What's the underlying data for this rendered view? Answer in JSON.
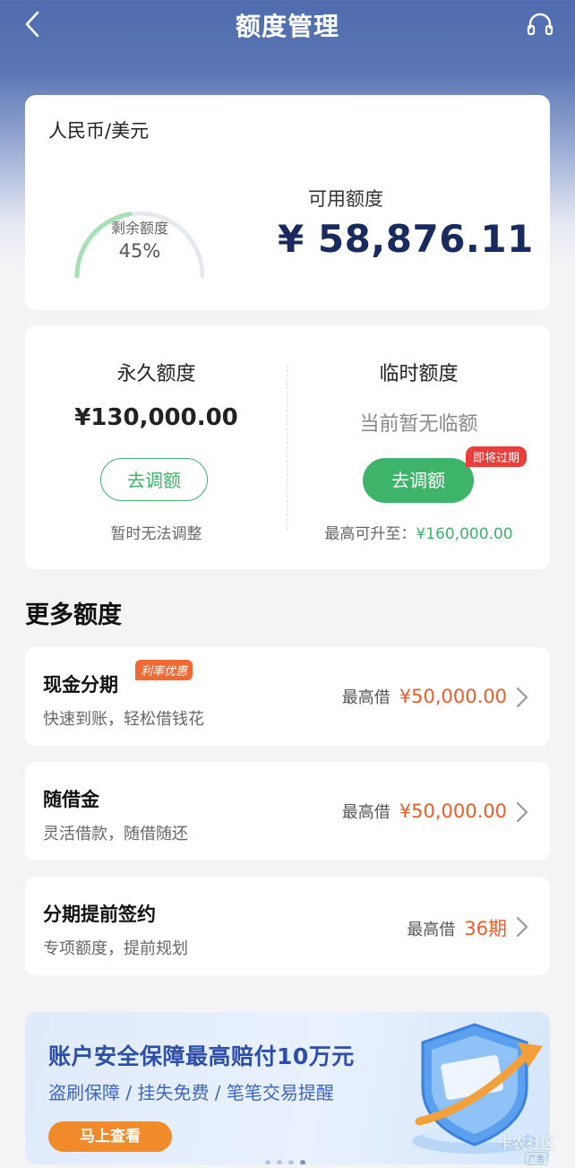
{
  "header": {
    "title": "额度管理"
  },
  "summary": {
    "currency": "人民币/美元",
    "ring_label": "剩余额度",
    "ring_percent": "45%",
    "ring_fraction": 0.45,
    "available_label": "可用额度",
    "available_amount": "¥ 58,876.11"
  },
  "quota": {
    "permanent": {
      "title": "永久额度",
      "value": "¥130,000.00",
      "button": "去调额",
      "note": "暂时无法调整"
    },
    "temporary": {
      "title": "临时额度",
      "value": "当前暂无临额",
      "badge": "即将过期",
      "button": "去调额",
      "note_prefix": "最高可升至：",
      "note_amount": "¥160,000.00"
    }
  },
  "more": {
    "title": "更多额度",
    "items": [
      {
        "title": "现金分期",
        "tag": "利率优惠",
        "subtitle": "快速到账，轻松借钱花",
        "prefix": "最高借",
        "amount": "¥50,000.00"
      },
      {
        "title": "随借金",
        "subtitle": "灵活借款，随借随还",
        "prefix": "最高借",
        "amount": "¥50,000.00"
      },
      {
        "title": "分期提前签约",
        "subtitle": "专项额度，提前规划",
        "prefix": "最高借",
        "amount": "36期"
      }
    ]
  },
  "banner": {
    "title": "账户安全保障最高赔付10万元",
    "subtitle": "盗刷保障 / 挂失免费 / 笔笔交易提醒",
    "button": "马上查看",
    "ad_label": "广告"
  },
  "watermark": "卡农社区",
  "colors": {
    "accent_green": "#3eb36a",
    "accent_orange": "#ef5a26",
    "navy": "#182a5e",
    "header_blue": "#4f6cae"
  }
}
